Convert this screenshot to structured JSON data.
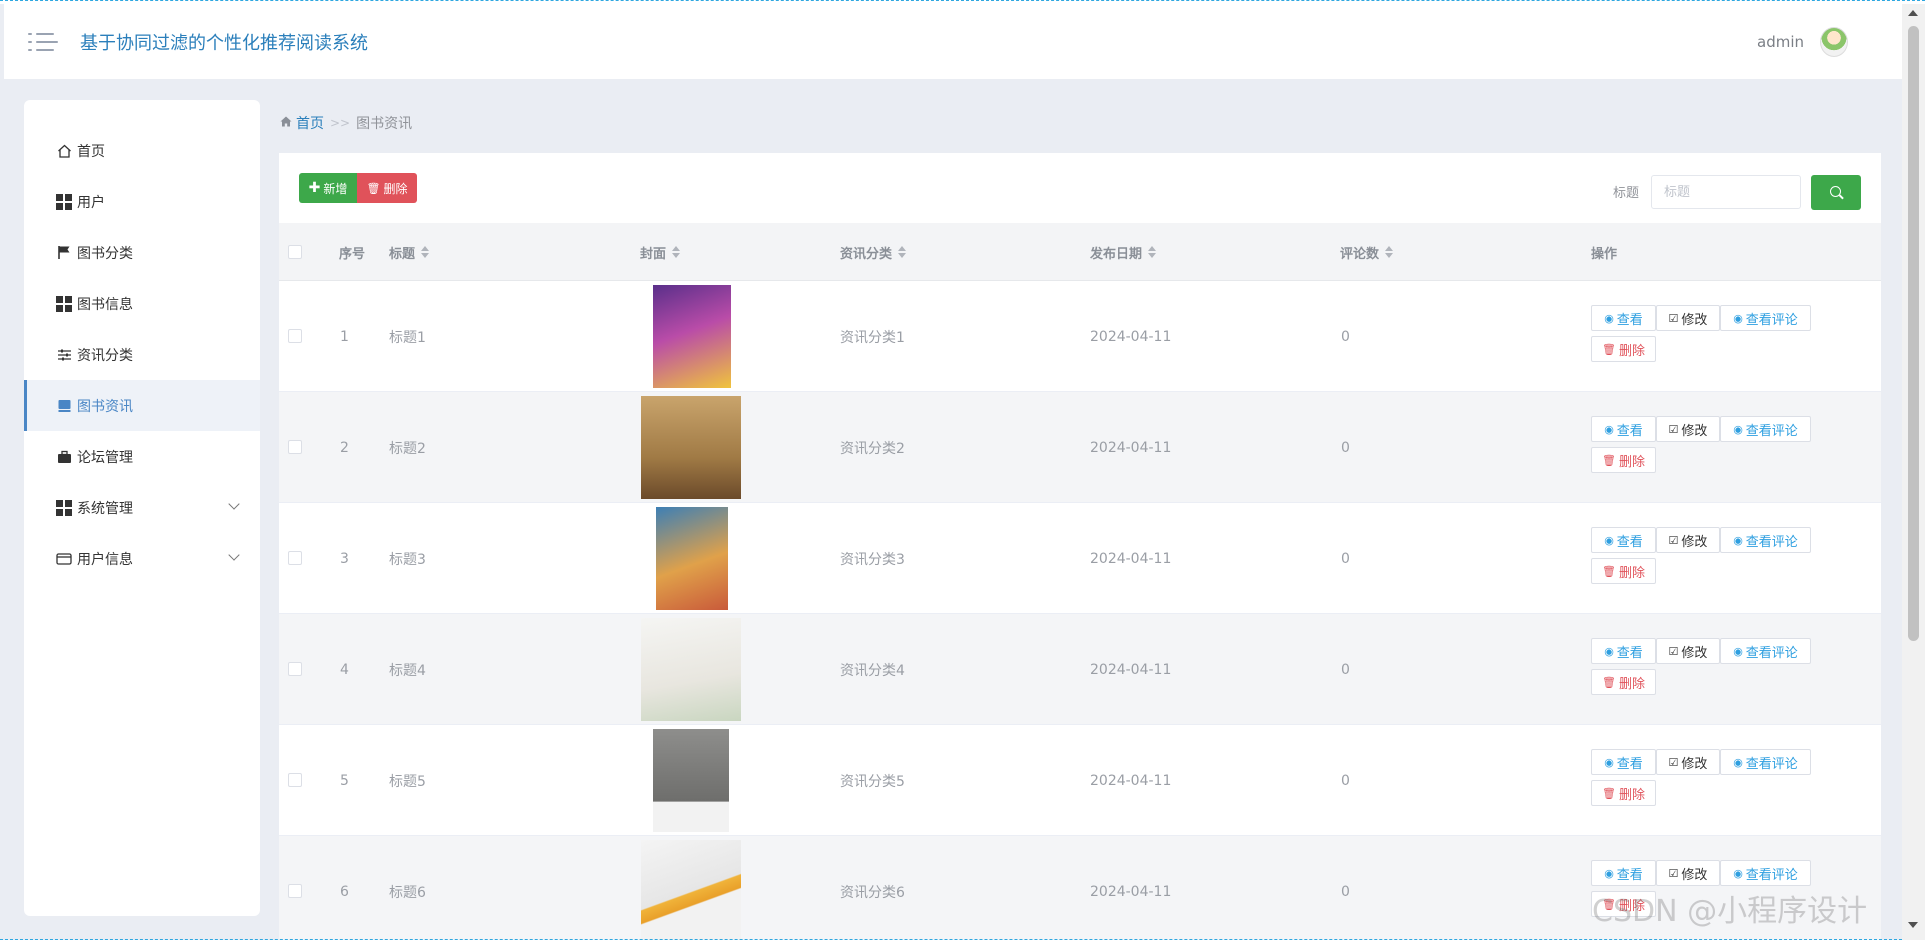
{
  "header": {
    "title": "基于协同过滤的个性化推荐阅读系统",
    "username": "admin"
  },
  "sidebar": {
    "items": [
      {
        "label": "首页",
        "icon": "home-icon"
      },
      {
        "label": "用户",
        "icon": "grid-icon"
      },
      {
        "label": "图书分类",
        "icon": "flag-icon"
      },
      {
        "label": "图书信息",
        "icon": "grid-icon"
      },
      {
        "label": "资讯分类",
        "icon": "sliders-icon"
      },
      {
        "label": "图书资讯",
        "icon": "book-icon",
        "active": true
      },
      {
        "label": "论坛管理",
        "icon": "briefcase-icon"
      },
      {
        "label": "系统管理",
        "icon": "grid-icon",
        "expandable": true
      },
      {
        "label": "用户信息",
        "icon": "card-icon",
        "expandable": true
      }
    ]
  },
  "breadcrumb": {
    "home": "首页",
    "separator": ">>",
    "current": "图书资讯"
  },
  "toolbar": {
    "add_label": "新增",
    "delete_label": "删除",
    "search_label": "标题",
    "search_placeholder": "标题"
  },
  "table": {
    "headers": {
      "index": "序号",
      "title": "标题",
      "cover": "封面",
      "category": "资讯分类",
      "date": "发布日期",
      "comments": "评论数",
      "actions": "操作"
    },
    "rows": [
      {
        "index": "1",
        "title": "标题1",
        "category": "资讯分类1",
        "date": "2024-04-11",
        "comments": "0"
      },
      {
        "index": "2",
        "title": "标题2",
        "category": "资讯分类2",
        "date": "2024-04-11",
        "comments": "0"
      },
      {
        "index": "3",
        "title": "标题3",
        "category": "资讯分类3",
        "date": "2024-04-11",
        "comments": "0"
      },
      {
        "index": "4",
        "title": "标题4",
        "category": "资讯分类4",
        "date": "2024-04-11",
        "comments": "0"
      },
      {
        "index": "5",
        "title": "标题5",
        "category": "资讯分类5",
        "date": "2024-04-11",
        "comments": "0"
      },
      {
        "index": "6",
        "title": "标题6",
        "category": "资讯分类6",
        "date": "2024-04-11",
        "comments": "0"
      }
    ],
    "row_actions": {
      "view": "查看",
      "edit": "修改",
      "view_comments": "查看评论",
      "delete": "删除"
    }
  },
  "watermark": "CSDN @小程序设计",
  "colors": {
    "brand_blue": "#2b7fbb",
    "add_green": "#3da84a",
    "delete_red": "#e0525a",
    "link_blue": "#2e9fe0"
  }
}
